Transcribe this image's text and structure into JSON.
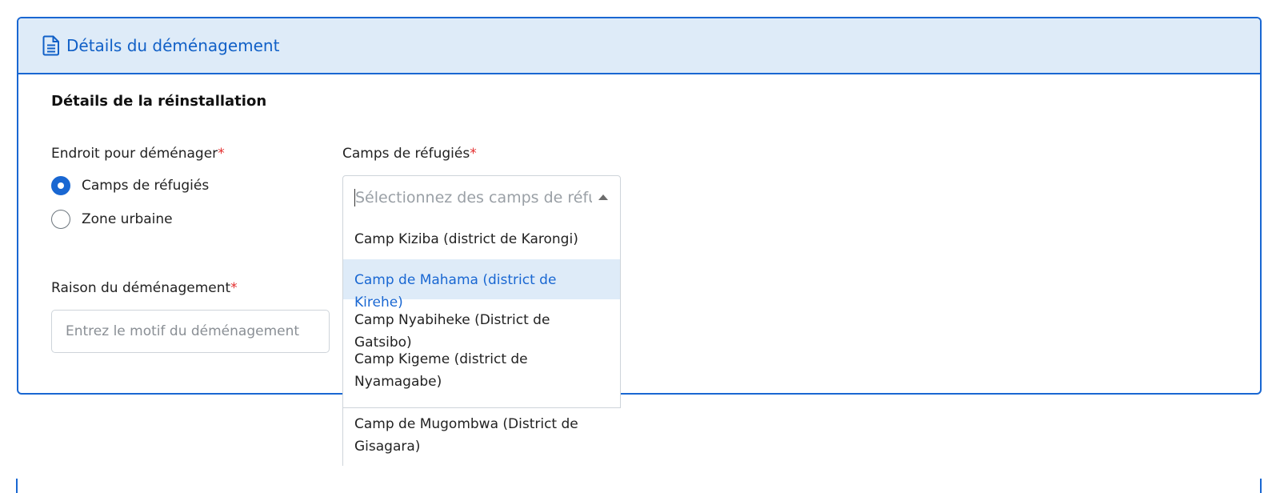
{
  "card": {
    "header_title": "Détails du déménagement",
    "icon": "document-icon"
  },
  "section": {
    "title": "Détails de la réinstallation"
  },
  "relocation_place": {
    "label": "Endroit pour déménager",
    "required_mark": "*",
    "options": [
      {
        "label": "Camps de réfugiés",
        "checked": true
      },
      {
        "label": "Zone urbaine",
        "checked": false
      }
    ]
  },
  "refugee_camps": {
    "label": "Camps de réfugiés",
    "required_mark": "*",
    "placeholder": "Sélectionnez des camps de réfugiés",
    "options": [
      {
        "label": "Camp Kiziba (district de Karongi)"
      },
      {
        "label": "Camp de Mahama (district de Kirehe)",
        "highlighted": true
      },
      {
        "label": "Camp Nyabiheke (District de Gatsibo)"
      },
      {
        "label": "Camp Kigeme (district de Nyamagabe)"
      },
      {
        "label": "Camp de Mugombwa (District de Gisagara)"
      }
    ]
  },
  "reason": {
    "label": "Raison du déménagement",
    "required_mark": "*",
    "placeholder": "Entrez le motif du déménagement",
    "value": ""
  },
  "colors": {
    "accent": "#1967d2",
    "header_bg": "#deebf8",
    "required": "#e32d2d"
  }
}
